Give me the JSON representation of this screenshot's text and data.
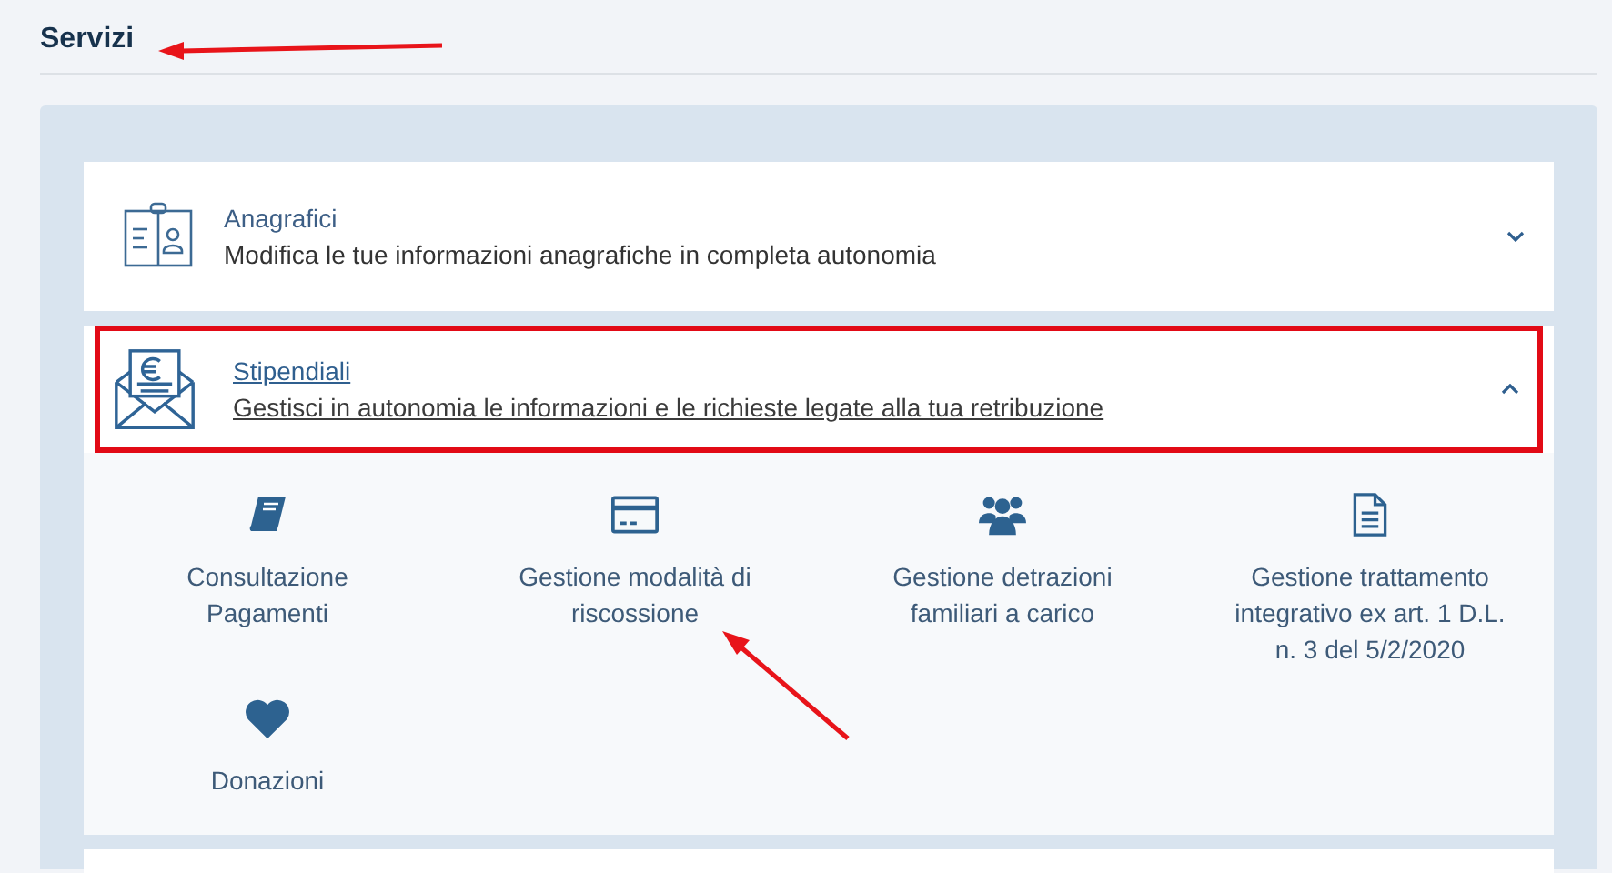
{
  "title": "Servizi",
  "sections": [
    {
      "kind": "id-card",
      "title": "Anagrafici",
      "subtitle": "Modifica le tue informazioni anagrafiche in completa autonomia",
      "expanded": false,
      "highlighted": false
    },
    {
      "kind": "envelope",
      "title": "Stipendiali",
      "subtitle": "Gestisci in autonomia le informazioni e le richieste legate alla tua retribuzione",
      "expanded": true,
      "highlighted": true,
      "services": [
        {
          "kind": "book",
          "label": "Consultazione Pagamenti"
        },
        {
          "kind": "card",
          "label": "Gestione modalità di riscossione"
        },
        {
          "kind": "people",
          "label": "Gestione detrazioni familiari a carico"
        },
        {
          "kind": "document",
          "label": "Gestione trattamento integrativo ex art. 1 D.L. n. 3 del 5/2/2020"
        },
        {
          "kind": "heart",
          "label": "Donazioni"
        }
      ]
    }
  ]
}
